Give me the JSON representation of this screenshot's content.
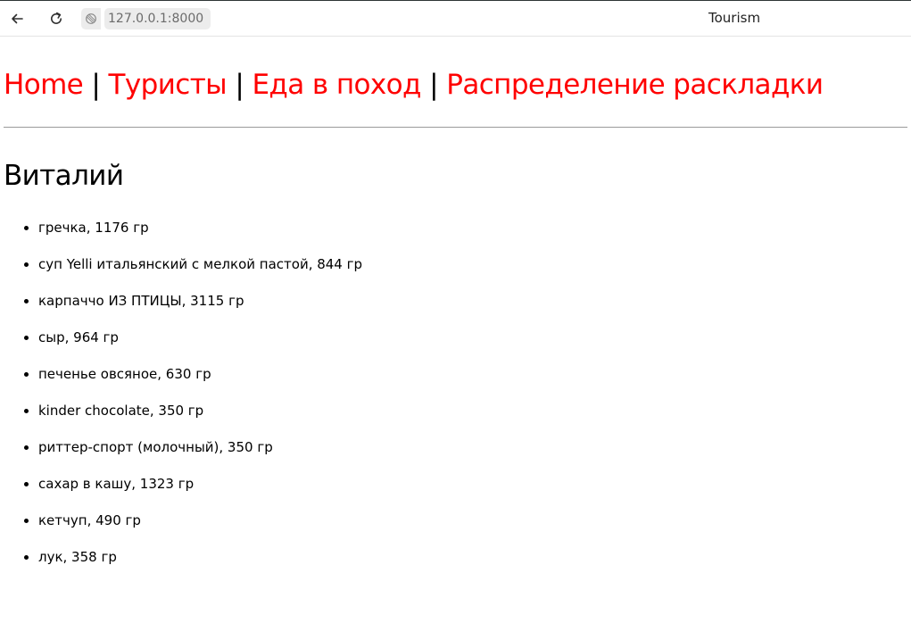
{
  "browser": {
    "url": "127.0.0.1:8000",
    "window_title": "Tourism",
    "icons": [
      "back-arrow-icon",
      "reload-icon",
      "site-info-icon"
    ]
  },
  "nav": {
    "links": [
      {
        "label": "Home"
      },
      {
        "label": "Туристы"
      },
      {
        "label": "Еда в поход"
      },
      {
        "label": "Распределение раскладки"
      }
    ],
    "separator": "|",
    "link_color": "#ff0000"
  },
  "tourist": {
    "name": "Виталий"
  },
  "food_items": [
    "гречка, 1176 гр",
    "суп Yelli итальянский с мелкой пастой, 844 гр",
    "карпаччо ИЗ ПТИЦЫ, 3115 гр",
    "сыр, 964 гр",
    "печенье овсяное, 630 гр",
    "kinder chocolate, 350 гр",
    "риттер-спорт (молочный), 350 гр",
    "сахар в кашу, 1323 гр",
    "кетчуп, 490 гр",
    "лук, 358 гр"
  ]
}
